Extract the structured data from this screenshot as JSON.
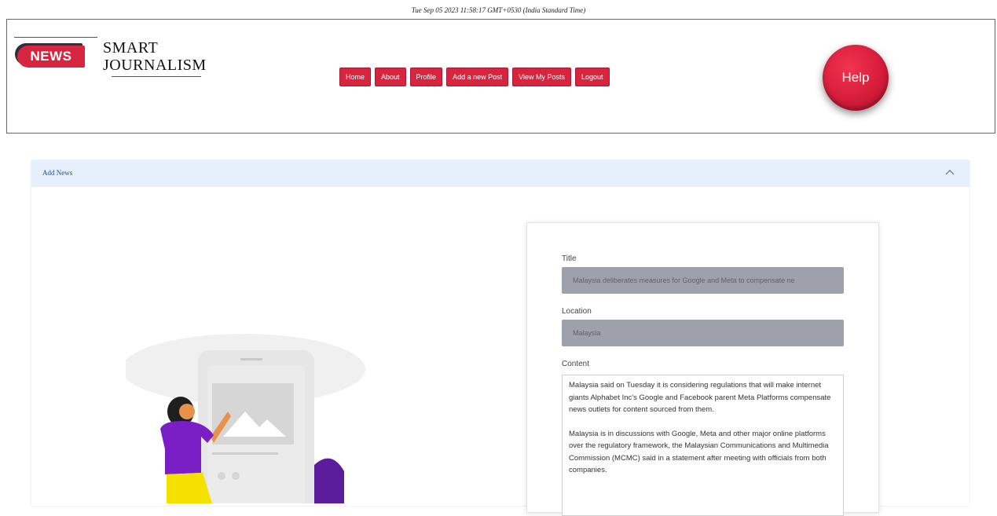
{
  "timestamp": "Tue Sep 05 2023 11:58:17 GMT+0530 (India Standard Time)",
  "logo": {
    "badge": "NEWS",
    "line1": "SMART",
    "line2": "JOURNALISM"
  },
  "nav": {
    "items": [
      {
        "label": "Home"
      },
      {
        "label": "About"
      },
      {
        "label": "Profile"
      },
      {
        "label": "Add a new Post"
      },
      {
        "label": "View My Posts"
      },
      {
        "label": "Logout"
      }
    ]
  },
  "help": {
    "label": "Help"
  },
  "panel": {
    "title": "Add News",
    "collapse_icon": "chevron-up-icon"
  },
  "form": {
    "title_label": "Title",
    "title_value": "Malaysia deliberates measures for Google and Meta to compensate ne",
    "location_label": "Location",
    "location_value": "Malaysia",
    "content_label": "Content",
    "content_paragraph1": "Malaysia said on Tuesday it is considering regulations that will make internet giants Alphabet Inc's Google and Facebook parent Meta Platforms compensate news outlets for content sourced from them.",
    "content_paragraph2": "Malaysia is in discussions with Google, Meta and other major online platforms over the regulatory framework, the Malaysian Communications and Multimedia Commission (MCMC) said in a statement after meeting with officials from both companies."
  },
  "colors": {
    "accent": "#d8253f",
    "panel_header": "#e6f0fc",
    "field_bg": "#9ea1ab"
  }
}
